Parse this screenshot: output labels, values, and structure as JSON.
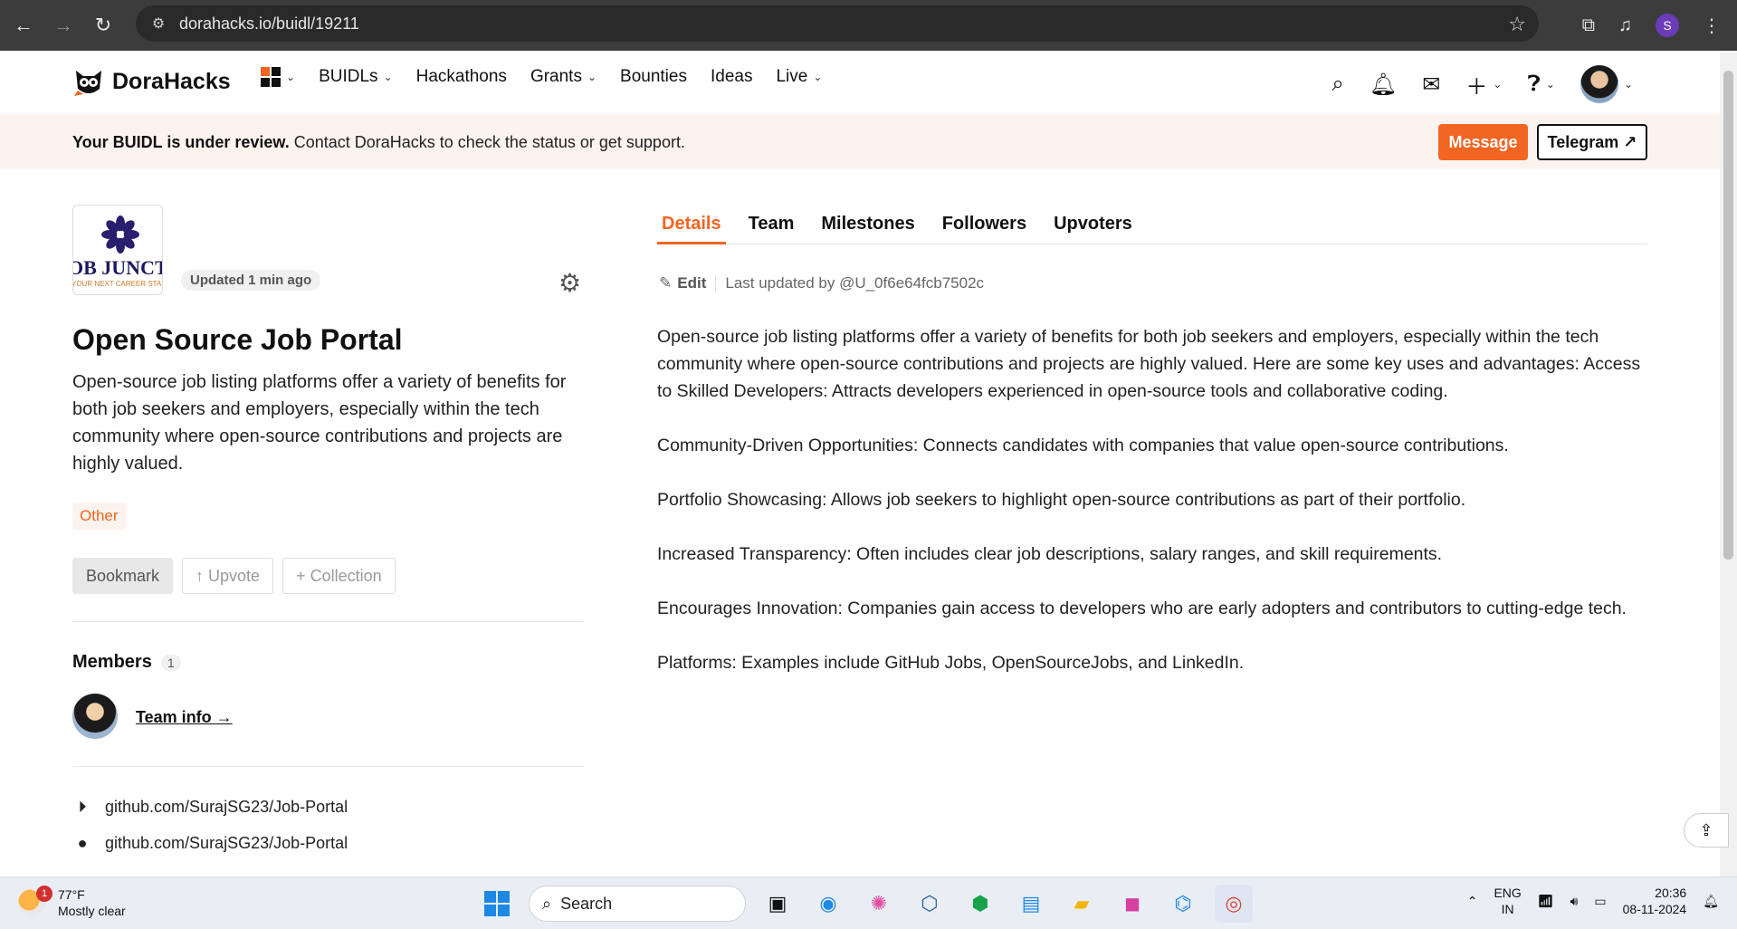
{
  "browser": {
    "url": "dorahacks.io/buidl/19211",
    "profile_initial": "S"
  },
  "header": {
    "brand": "DoraHacks",
    "nav": [
      "BUIDLs",
      "Hackathons",
      "Grants",
      "Bounties",
      "Ideas",
      "Live"
    ]
  },
  "banner": {
    "bold": "Your BUIDL is under review.",
    "text": " Contact DoraHacks to check the status or get support.",
    "message_button": "Message",
    "telegram_button": "Telegram ↗"
  },
  "project": {
    "logo_text": "OB JUNCTI",
    "logo_tagline": "YOUR NEXT CAREER STARTS H",
    "updated": "Updated 1 min ago",
    "title": "Open Source Job Portal",
    "description": "Open-source job listing platforms offer a variety of benefits for both job seekers and employers, especially within the tech community where open-source contributions and projects are highly valued.",
    "category": "Other",
    "buttons": {
      "bookmark": "Bookmark",
      "upvote": "↑ Upvote",
      "collection": "+ Collection"
    },
    "members_label": "Members",
    "members_count": "1",
    "team_info": "Team info →",
    "links": [
      "github.com/SurajSG23/Job-Portal",
      "github.com/SurajSG23/Job-Portal"
    ]
  },
  "tabs": [
    "Details",
    "Team",
    "Milestones",
    "Followers",
    "Upvoters"
  ],
  "details": {
    "edit_label": "Edit",
    "last_updated": "Last updated by @U_0f6e64fcb7502c",
    "paragraphs": [
      "Open-source job listing platforms offer a variety of benefits for both job seekers and employers, especially within the tech community where open-source contributions and projects are highly valued. Here are some key uses and advantages: Access to Skilled Developers: Attracts developers experienced in open-source tools and collaborative coding.",
      "Community-Driven Opportunities: Connects candidates with companies that value open-source contributions.",
      "Portfolio Showcasing: Allows job seekers to highlight open-source contributions as part of their portfolio.",
      "Increased Transparency: Often includes clear job descriptions, salary ranges, and skill requirements.",
      "Encourages Innovation: Companies gain access to developers who are early adopters and contributors to cutting-edge tech.",
      "Platforms: Examples include GitHub Jobs, OpenSourceJobs, and LinkedIn."
    ]
  },
  "taskbar": {
    "weather_temp": "77°F",
    "weather_desc": "Mostly clear",
    "weather_badge": "1",
    "search_label": "Search",
    "lang_top": "ENG",
    "lang_bottom": "IN",
    "time": "20:36",
    "date": "08-11-2024"
  },
  "colors": {
    "accent": "#f26522",
    "banner_bg": "#fdf3ee"
  }
}
